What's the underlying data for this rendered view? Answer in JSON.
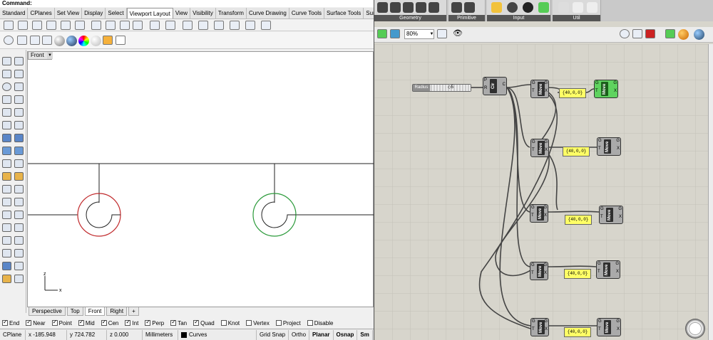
{
  "rhino": {
    "command_label": "Command:",
    "tabs": [
      "Standard",
      "CPlanes",
      "Set View",
      "Display",
      "Select",
      "Viewport Layout",
      "View",
      "Visibility",
      "Transform",
      "Curve Drawing",
      "Curve Tools",
      "Surface Tools",
      "Surfac"
    ],
    "active_tab": "Viewport Layout",
    "viewport_title": "Front",
    "axis_x": "x",
    "axis_z": "z",
    "viewport_tabs": [
      "Perspective",
      "Top",
      "Front",
      "Right"
    ],
    "active_viewport_tab": "Front",
    "osnaps": [
      {
        "label": "End",
        "checked": true
      },
      {
        "label": "Near",
        "checked": true
      },
      {
        "label": "Point",
        "checked": true
      },
      {
        "label": "Mid",
        "checked": true
      },
      {
        "label": "Cen",
        "checked": true
      },
      {
        "label": "Int",
        "checked": true
      },
      {
        "label": "Perp",
        "checked": true
      },
      {
        "label": "Tan",
        "checked": true
      },
      {
        "label": "Quad",
        "checked": true
      },
      {
        "label": "Knot",
        "checked": false
      },
      {
        "label": "Vertex",
        "checked": false
      },
      {
        "label": "Project",
        "checked": false
      },
      {
        "label": "Disable",
        "checked": false
      }
    ],
    "status": {
      "cplane": "CPlane",
      "x": "x -185.948",
      "y": "y 724.782",
      "z": "z 0.000",
      "units": "Millimeters",
      "layer": "Curves",
      "grid_snap": "Grid Snap",
      "ortho": "Ortho",
      "planar": "Planar",
      "osnap": "Osnap",
      "smarttrack": "Sm"
    }
  },
  "grasshopper": {
    "ribbon_groups": [
      "Geometry",
      "Primitive",
      "Input",
      "Util"
    ],
    "zoom": "80%",
    "slider": {
      "label": "Radius",
      "value": "5"
    },
    "circle_component": {
      "name": "Cir",
      "inputs": [
        "P",
        "R"
      ],
      "output": "C"
    },
    "move_components": [
      {
        "name": "Move",
        "inputs": [
          "G",
          "T"
        ],
        "outputs": [
          "G",
          "X"
        ]
      },
      {
        "name": "Move",
        "inputs": [
          "G",
          "T"
        ],
        "outputs": [
          "G",
          "X"
        ]
      },
      {
        "name": "Move",
        "inputs": [
          "G",
          "T"
        ],
        "outputs": [
          "G",
          "X"
        ]
      },
      {
        "name": "Move",
        "inputs": [
          "G",
          "T"
        ],
        "outputs": [
          "G",
          "X"
        ]
      },
      {
        "name": "Move",
        "inputs": [
          "G",
          "T"
        ],
        "outputs": [
          "G",
          "X"
        ]
      },
      {
        "name": "Move",
        "inputs": [
          "G",
          "T"
        ],
        "outputs": [
          "G",
          "X"
        ]
      },
      {
        "name": "Move",
        "inputs": [
          "G",
          "T"
        ],
        "outputs": [
          "G",
          "X"
        ]
      },
      {
        "name": "Move",
        "inputs": [
          "G",
          "T"
        ],
        "outputs": [
          "G",
          "X"
        ]
      },
      {
        "name": "Move",
        "inputs": [
          "G",
          "T"
        ],
        "outputs": [
          "G",
          "X"
        ]
      },
      {
        "name": "Move",
        "inputs": [
          "G",
          "T"
        ],
        "outputs": [
          "G",
          "X"
        ]
      }
    ],
    "panels": [
      "{40,0,0}",
      "{40,0,0}",
      "{40,0,0}",
      "{40,0,0}",
      "{40,0,0}"
    ]
  },
  "colors": {
    "circle_red": "#c0292b",
    "circle_green": "#2b9a3a",
    "canvas": "#d7d5cc",
    "panel": "#ffff66",
    "component_selected": "#5fd35f"
  }
}
